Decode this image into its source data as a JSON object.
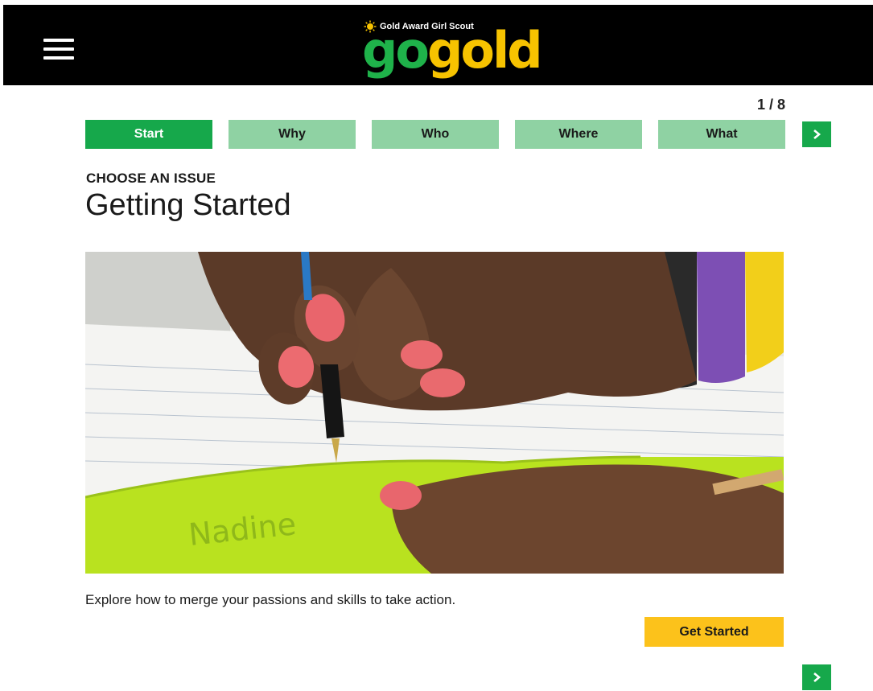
{
  "header": {
    "menu_icon": "hamburger-menu-icon",
    "logo": {
      "tagline": "Gold Award Girl Scout",
      "word_part1": "go",
      "word_part2": "gold"
    }
  },
  "stepper": {
    "counter": "1 / 8",
    "steps": [
      {
        "label": "Start",
        "active": true
      },
      {
        "label": "Why",
        "active": false
      },
      {
        "label": "Who",
        "active": false
      },
      {
        "label": "Where",
        "active": false
      },
      {
        "label": "What",
        "active": false
      }
    ],
    "next_icon": "chevron-right-icon"
  },
  "content": {
    "eyebrow": "CHOOSE AN ISSUE",
    "title": "Getting Started",
    "description": "Explore how to merge your passions and skills to take action.",
    "cta_label": "Get Started"
  },
  "colors": {
    "header_bg": "#000000",
    "brand_green": "#16a84b",
    "step_inactive": "#8fd2a3",
    "brand_gold": "#fcc21b"
  }
}
